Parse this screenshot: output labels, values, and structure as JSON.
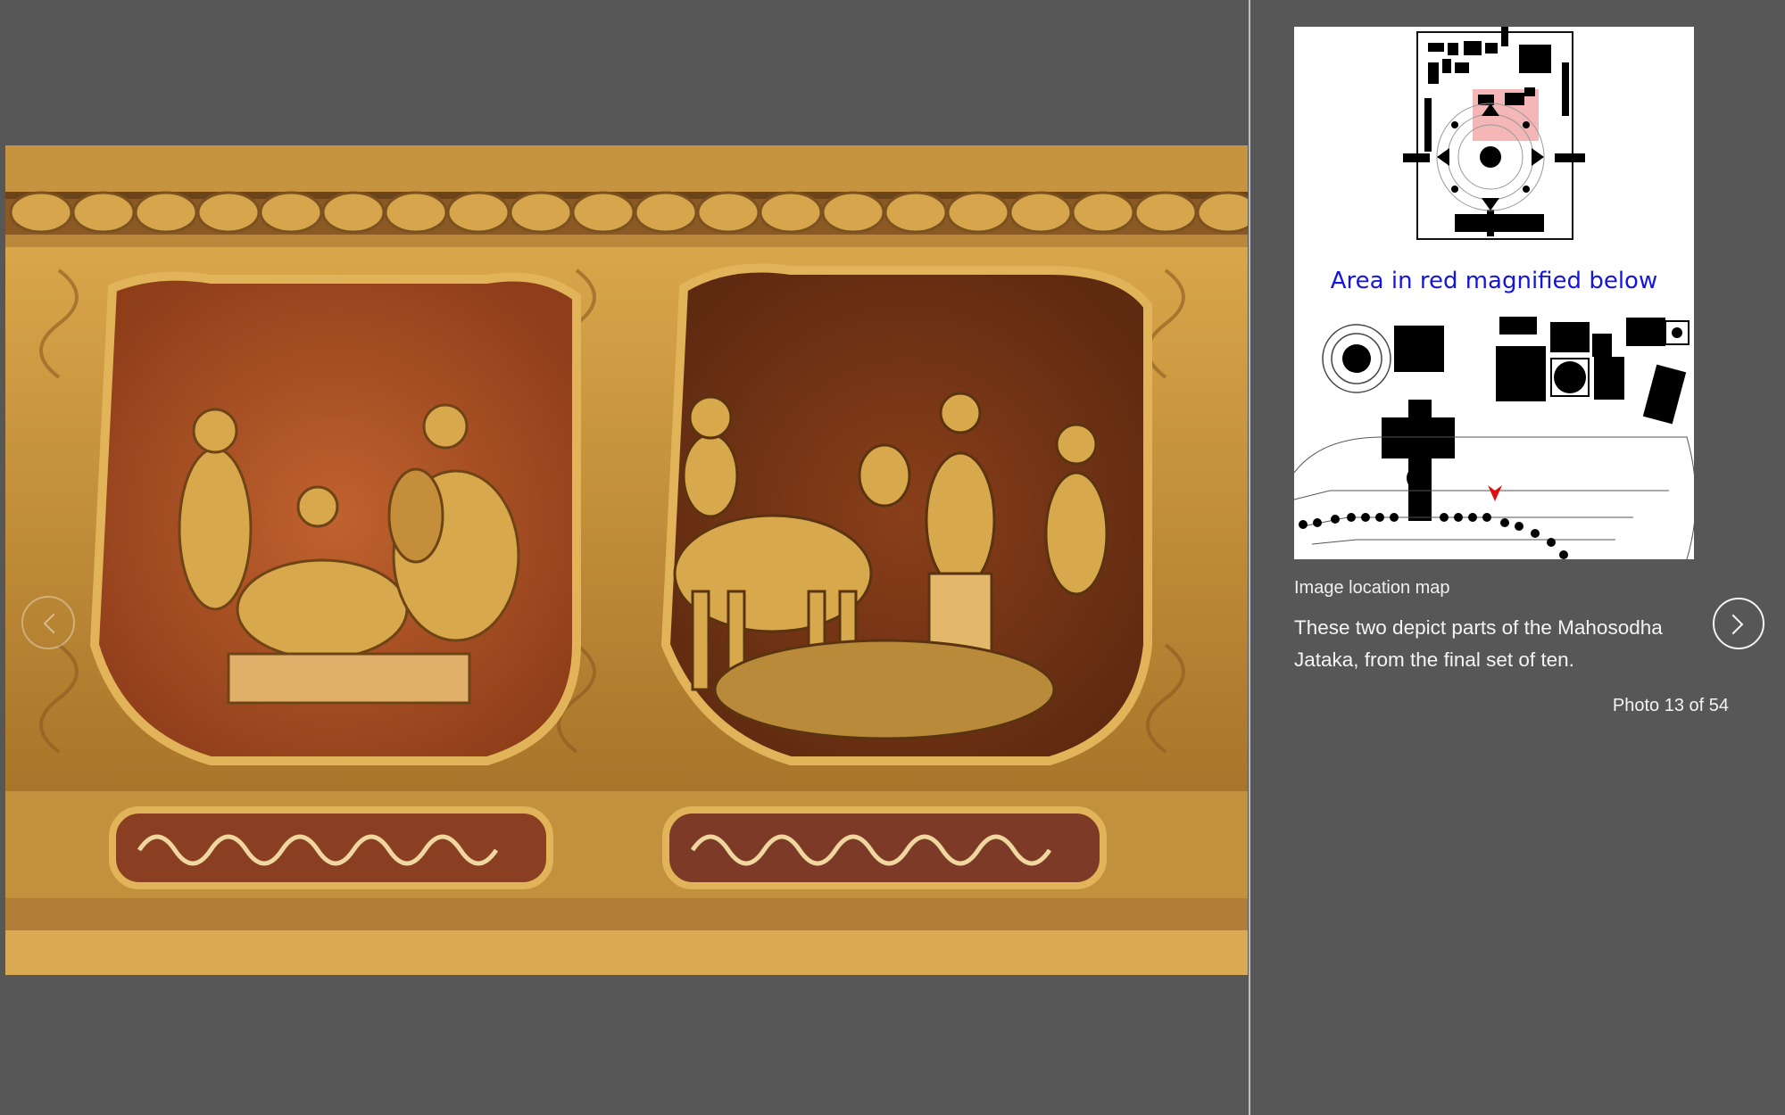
{
  "photo": {
    "description_alt": "Glazed tile reliefs"
  },
  "map": {
    "caption": "Area in red magnified below",
    "label": "Image location map"
  },
  "description": "These two depict parts of the Mahosodha Jataka, from the final set of ten.",
  "counter": "Photo 13 of 54",
  "icons": {
    "prev": "chevron-left-icon",
    "next": "chevron-right-icon"
  },
  "colors": {
    "background": "#575757",
    "map_caption": "#1515e0",
    "highlight": "#f4b6b6",
    "arrow": "#e01010"
  }
}
